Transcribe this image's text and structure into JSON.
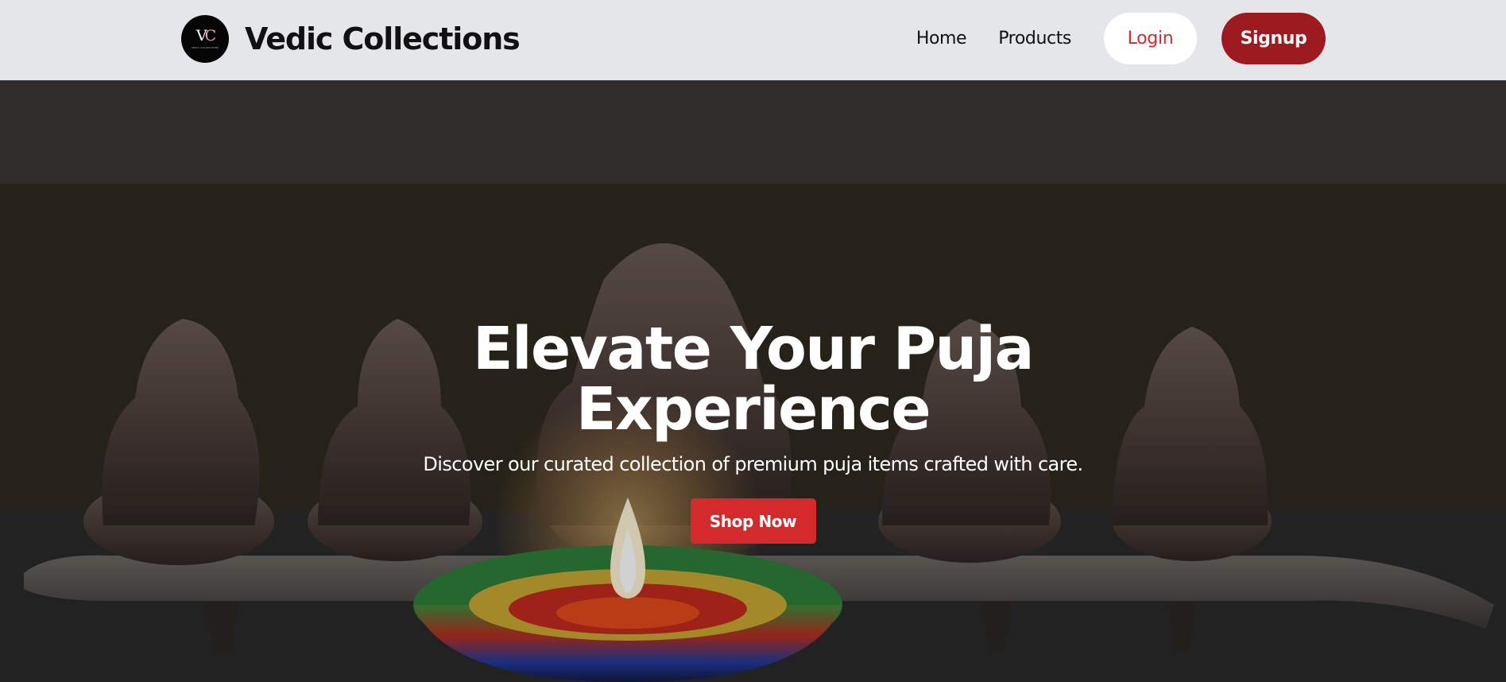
{
  "brand": {
    "logo_text": "VC",
    "logo_subtext": "VEDIC COLLECTIONS",
    "name": "Vedic Collections"
  },
  "nav": {
    "home": "Home",
    "products": "Products",
    "login": "Login",
    "signup": "Signup"
  },
  "hero": {
    "title": "Elevate Your Puja Experience",
    "subtitle": "Discover our curated collection of premium puja items crafted with care.",
    "cta": "Shop Now",
    "image": "ganesha-idols-with-diya-photo"
  },
  "colors": {
    "header_bg": "#e5e6ea",
    "signup_bg": "#9c1a20",
    "login_text": "#d42a2a",
    "cta_bg": "#d52a2b"
  }
}
